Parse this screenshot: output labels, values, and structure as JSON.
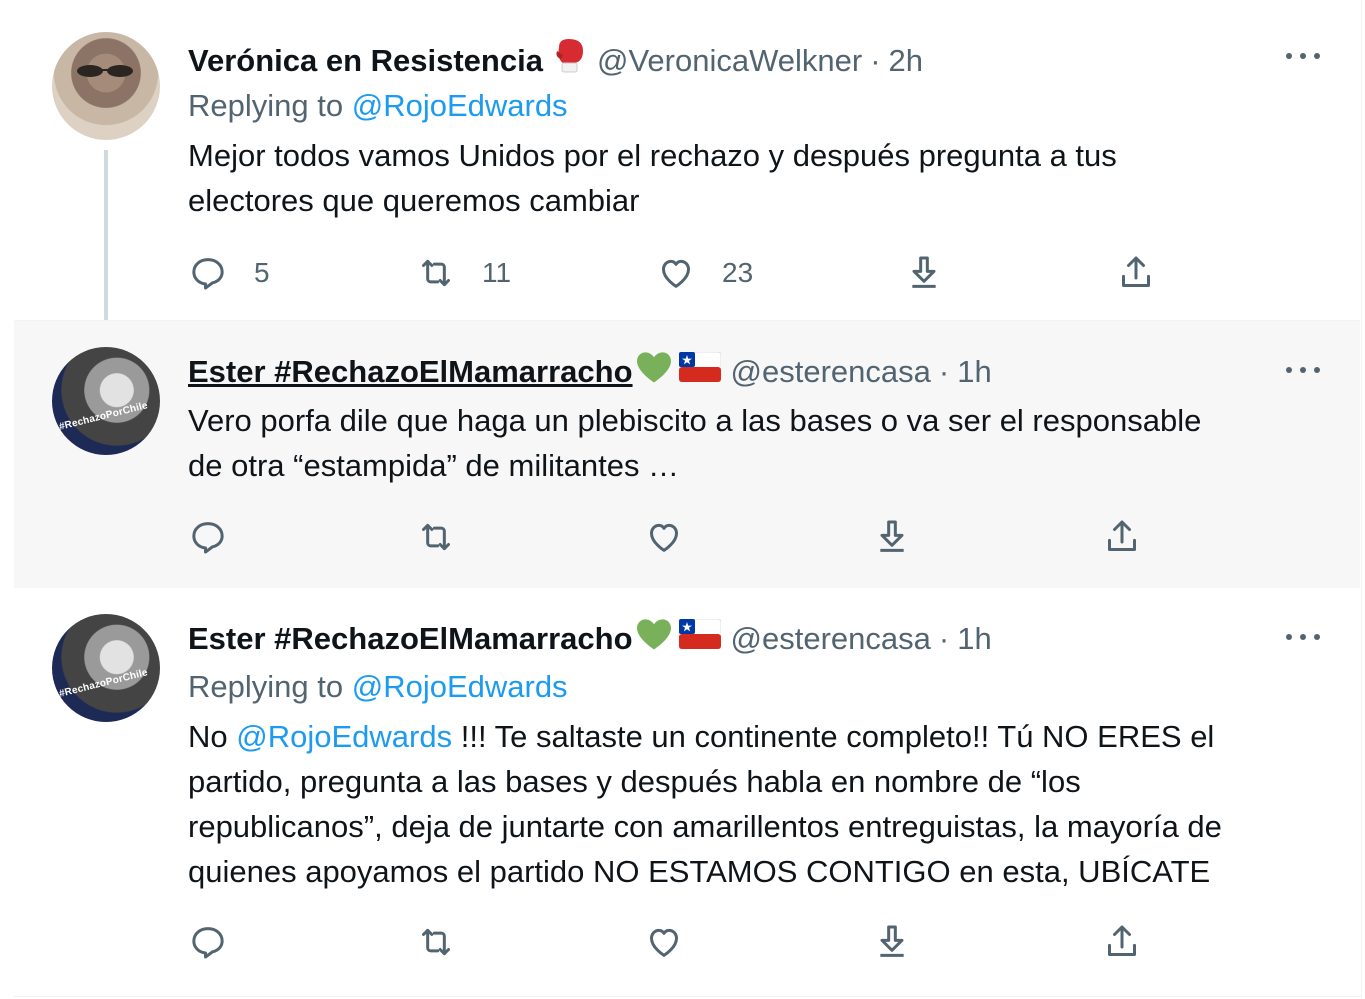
{
  "tweets": [
    {
      "name": "Verónica en Resistencia",
      "handle": "@VeronicaWelkner",
      "time": "2h",
      "replying_prefix": "Replying to",
      "replying_to": "@RojoEdwards",
      "text_line1": "Mejor todos vamos Unidos por el rechazo y después pregunta a tus",
      "text_line2": "electores que queremos cambiar",
      "replies": "5",
      "retweets": "11",
      "likes": "23"
    },
    {
      "name": "Ester #RechazoElMamarracho",
      "handle": "@esterencasa",
      "time": "1h",
      "text_line1": "Vero porfa dile que haga un plebiscito a las bases o va ser el responsable",
      "text_line2": "de otra “estampida” de militantes …"
    },
    {
      "name": "Ester #RechazoElMamarracho",
      "handle": "@esterencasa",
      "time": "1h",
      "replying_prefix": "Replying to",
      "replying_to": "@RojoEdwards",
      "text_prefix": "No",
      "text_mention": "@RojoEdwards",
      "text_line1_rest": "!!! Te saltaste un continente completo!! Tú NO ERES el",
      "text_line2": "partido, pregunta a las bases y después habla en nombre de “los",
      "text_line3": "republicanos”, deja de juntarte con amarillentos entreguistas, la mayoría de",
      "text_line4": "quienes apoyamos el partido NO ESTAMOS CONTIGO en esta, UBÍCATE"
    }
  ],
  "avatar_text": "#RechazoPorChile",
  "colors": {
    "accent": "#1d9bf0",
    "muted": "#536471",
    "text": "#0f1419",
    "highlight_bg": "#f7f7f7"
  },
  "icons": [
    "reply-icon",
    "retweet-icon",
    "like-icon",
    "download-icon",
    "share-icon",
    "more-icon",
    "boxing-glove-icon",
    "green-heart-icon",
    "chile-flag-icon"
  ]
}
